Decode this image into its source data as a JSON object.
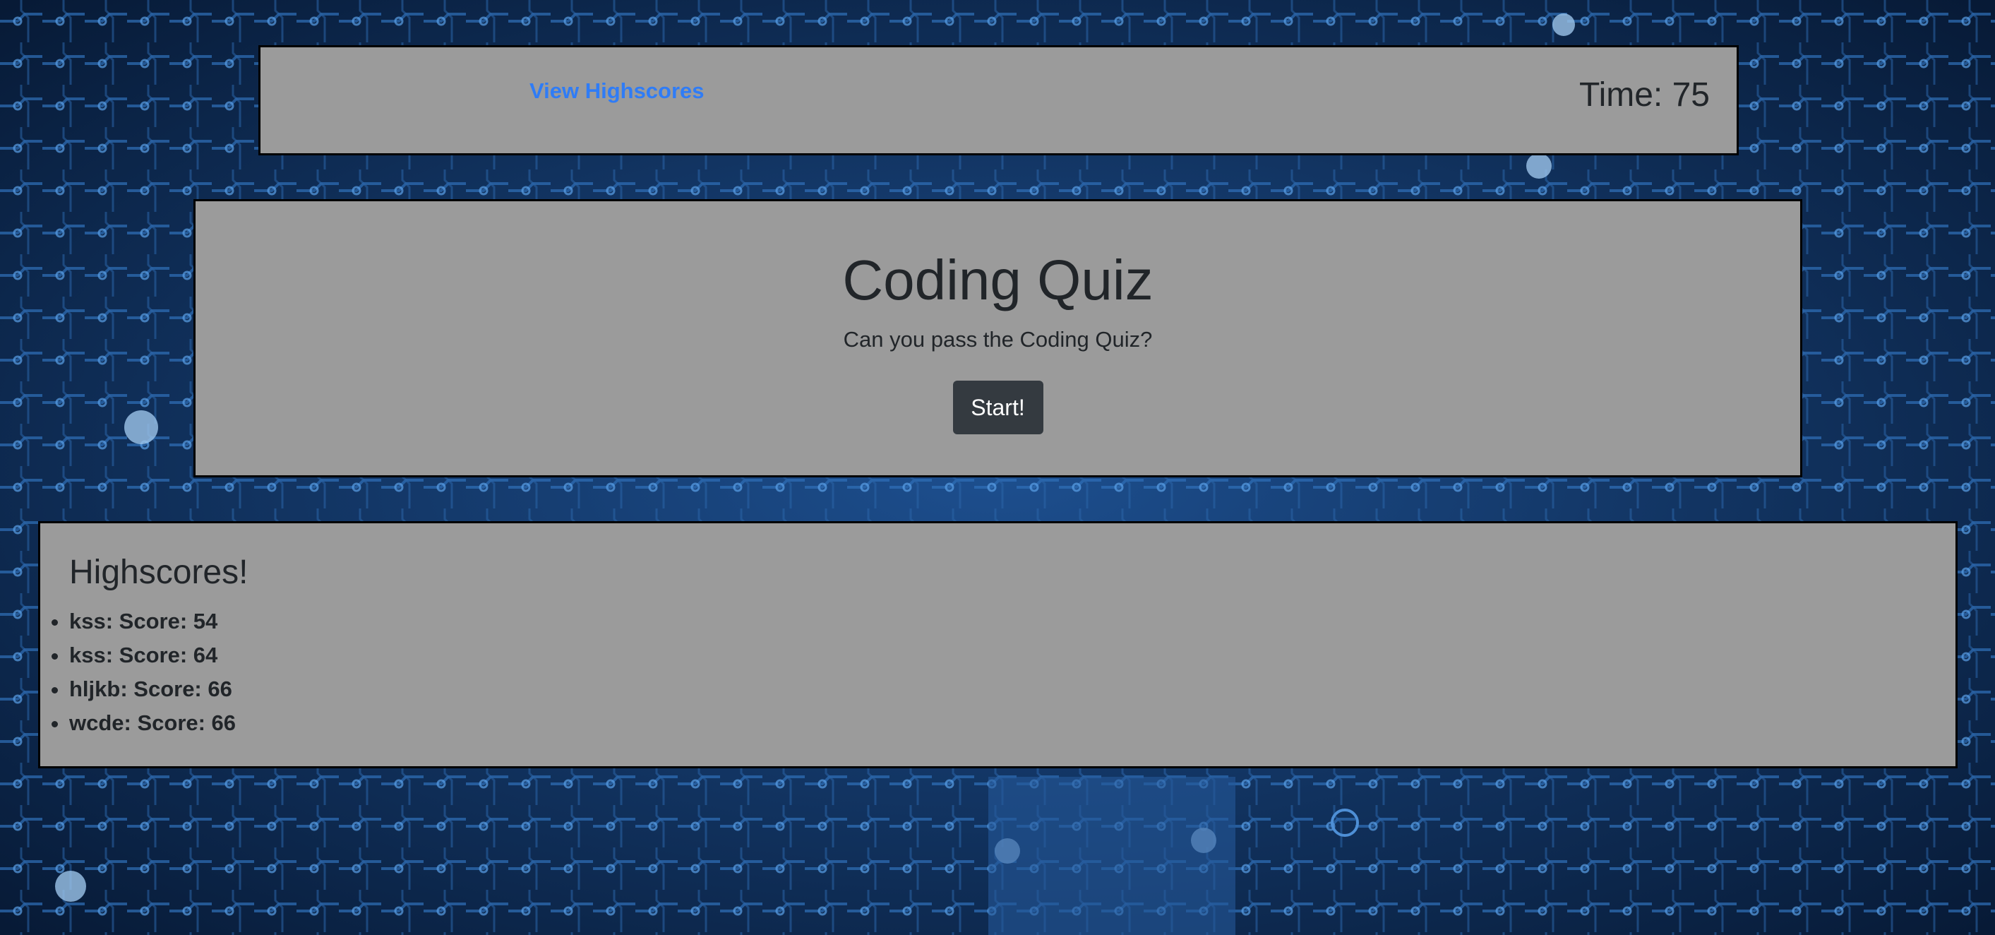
{
  "header": {
    "view_highscores_label": "View Highscores",
    "timer_text": "Time: 75"
  },
  "quiz": {
    "title": "Coding Quiz",
    "subtitle": "Can you pass the Coding Quiz?",
    "start_label": "Start!"
  },
  "highscores": {
    "title": "Highscores!",
    "entries": [
      "kss: Score: 54",
      "kss: Score: 64",
      "hljkb: Score: 66",
      "wcde: Score: 66"
    ]
  },
  "colors": {
    "panel_bg": "#9b9b9b",
    "link": "#2f7cf6",
    "button_bg": "#343a40",
    "background": "#0b1f3f"
  }
}
